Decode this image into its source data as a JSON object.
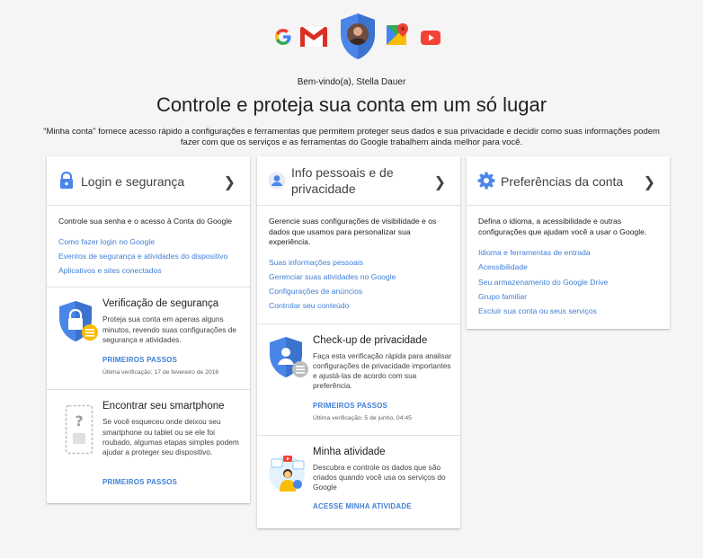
{
  "header": {
    "welcome": "Bem-vindo(a), Stella Dauer",
    "headline": "Controle e proteja sua conta em um só lugar",
    "intro": "\"Minha conta\" fornece acesso rápido a configurações e ferramentas que permitem proteger seus dados e sua privacidade e decidir como suas informações podem fazer com que os serviços e as ferramentas do Google trabalhem ainda melhor para você.",
    "icons": [
      "google-g-icon",
      "gmail-icon",
      "account-shield-avatar-icon",
      "maps-icon",
      "youtube-icon"
    ]
  },
  "login_card": {
    "title": "Login e segurança",
    "description": "Controle sua senha e o acesso à Conta do Google",
    "links": [
      "Como fazer login no Google",
      "Eventos de segurança e atividades do dispositivo",
      "Aplicativos e sites conectados"
    ]
  },
  "security_checkup": {
    "title": "Verificação de segurança",
    "text": "Proteja sua conta em apenas alguns minutos, revendo suas configurações de segurança e atividades.",
    "button": "PRIMEIROS PASSOS",
    "meta": "Última verificação: 17 de fevereiro de 2016"
  },
  "find_phone": {
    "title": "Encontrar seu smartphone",
    "text": "Se você esqueceu onde deixou seu smartphone ou tablet ou se ele foi roubado, algumas etapas simples podem ajudar a proteger seu dispositivo.",
    "button": "PRIMEIROS PASSOS"
  },
  "personal_card": {
    "title_line1": "Info pessoais e de",
    "title_line2": "privacidade",
    "description": "Gerencie suas configurações de visibilidade e os dados que usamos para personalizar sua experiência.",
    "links": [
      "Suas informações pessoais",
      "Gerenciar suas atividades no Google",
      "Configurações de anúncios",
      "Controlar seu conteúdo"
    ]
  },
  "privacy_checkup": {
    "title": "Check-up de privacidade",
    "text": "Faça esta verificação rápida para analisar configurações de privacidade importantes e ajustá-las de acordo com sua preferência.",
    "button": "PRIMEIROS PASSOS",
    "meta": "Última verificação: 5 de junho, 04:45"
  },
  "my_activity": {
    "title": "Minha atividade",
    "text": "Descubra e controle os dados que são criados quando você usa os serviços do Google",
    "button": "ACESSE MINHA ATIVIDADE"
  },
  "prefs_card": {
    "title": "Preferências da conta",
    "description": "Defina o idioma, a acessibilidade e outras configurações que ajudam você a usar o Google.",
    "links": [
      "Idioma e ferramentas de entrada",
      "Acessibilidade",
      "Seu armazenamento do Google Drive",
      "Grupo familiar",
      "Excluir sua conta ou seus serviços"
    ]
  },
  "colors": {
    "link": "#3f7fd6",
    "shield": "#4a86e8",
    "background": "#f5f5f5"
  }
}
